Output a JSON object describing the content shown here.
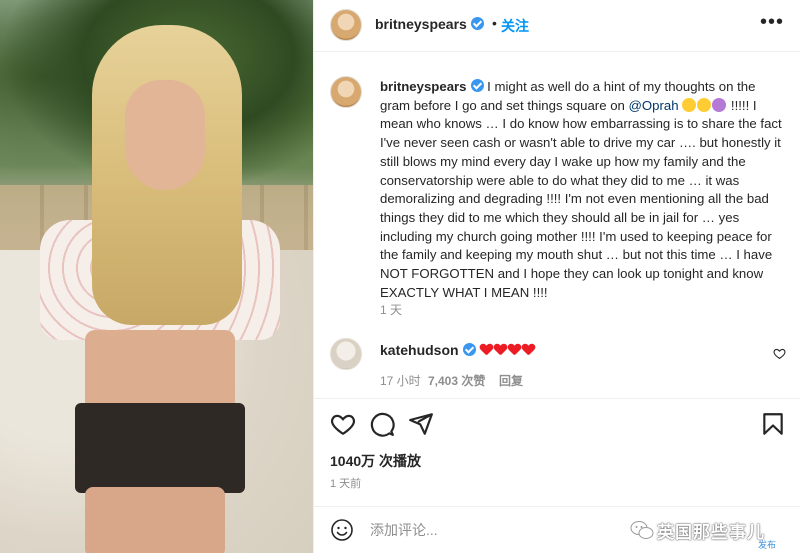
{
  "post": {
    "author": "britneyspears",
    "separator": "•",
    "follow_label": "关注",
    "more_label": "•••"
  },
  "caption": {
    "username": "britneyspears",
    "text_before": " I might as well do a hint of my thoughts on the gram before I go and set things square on ",
    "mention": "@Oprah",
    "text_after": " !!!!! I mean who knows … I do know how embarrassing is to share the fact I've never seen cash or wasn't able to drive my car …. but honestly it still blows my mind every day I wake up how my family and the conservatorship were able to do what they did to me … it was demoralizing and degrading !!!! I'm not even mentioning all the bad things they did to me which they should all be in jail for … yes including my church going mother !!!! I'm used to keeping peace for the family and keeping my mouth shut … but not this time … I have NOT FORGOTTEN and I hope they can look up tonight and know EXACTLY WHAT I MEAN !!!!",
    "time": "1 天"
  },
  "comment": {
    "username": "katehudson",
    "time": "17 小时",
    "likes": "7,403 次赞",
    "reply_label": "回复"
  },
  "stats": {
    "plays": "1040万 次播放",
    "date": "1 天前"
  },
  "add_comment": {
    "placeholder": "添加评论..."
  },
  "watermark": {
    "text": "英国那些事儿",
    "publish": "发布"
  },
  "colors": {
    "accent": "#0095f6",
    "verified": "#3897f0",
    "mention": "#00376b",
    "heart": "#ed1c24",
    "muted": "#8e8e8e"
  }
}
